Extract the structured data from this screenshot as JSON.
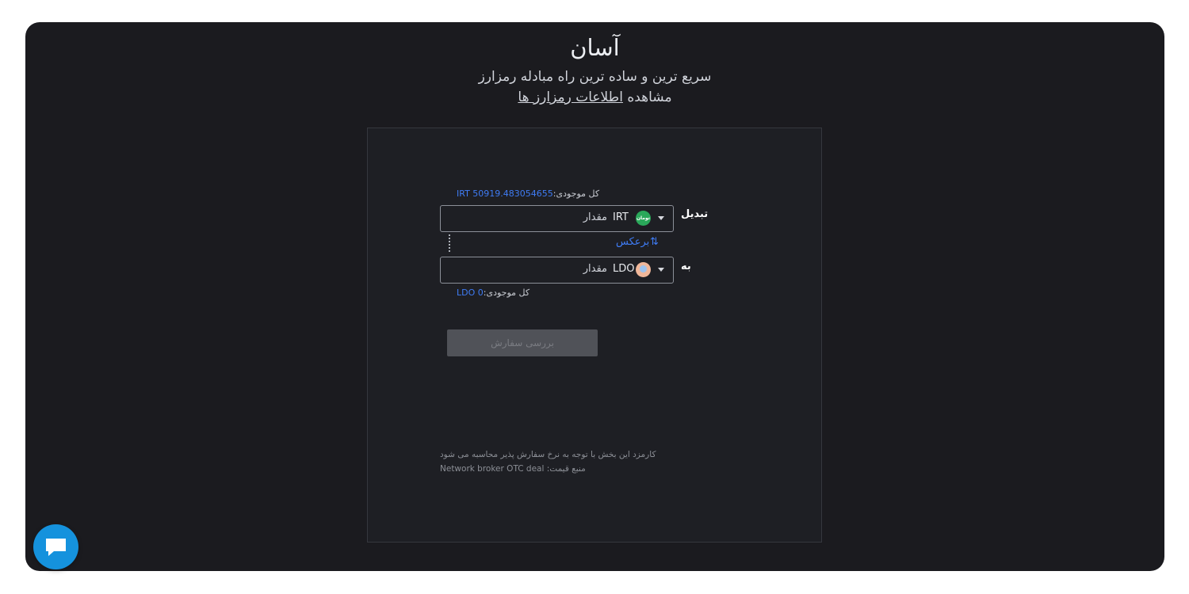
{
  "hero": {
    "title": "آسان",
    "subtitle": "سریع ترین و ساده ترین راه مبادله رمزارز",
    "view_prefix": "مشاهده",
    "view_link": "اطلاعات رمزارز ها"
  },
  "exchange": {
    "from": {
      "label": "تبدیل",
      "currency": "IRT",
      "coin_text": "تومان",
      "amount_placeholder": "مقدار",
      "balance_label": "کل موجودی:",
      "balance_value": "IRT 50919.483054655"
    },
    "swap_label": "برعکس",
    "swap_icon": "swap-vertical-icon",
    "to": {
      "label": "به",
      "currency": "LDO",
      "amount_placeholder": "مقدار",
      "balance_label": "کل موجودی:",
      "balance_value": "LDO 0"
    },
    "review_button": "بررسی سفارش",
    "fee_note": "کارمزد این بخش با توجه به نرخ سفارش پذیر محاسبه می شود",
    "price_source": "منبع قیمت: Network broker OTC deal"
  },
  "chat": {
    "icon": "chat-bubble-icon"
  },
  "colors": {
    "background": "#1b1b1f",
    "card": "#1e1f24",
    "accent": "#3f7cf5",
    "chat": "#1592dd",
    "irt_coin": "#2aa85a"
  }
}
